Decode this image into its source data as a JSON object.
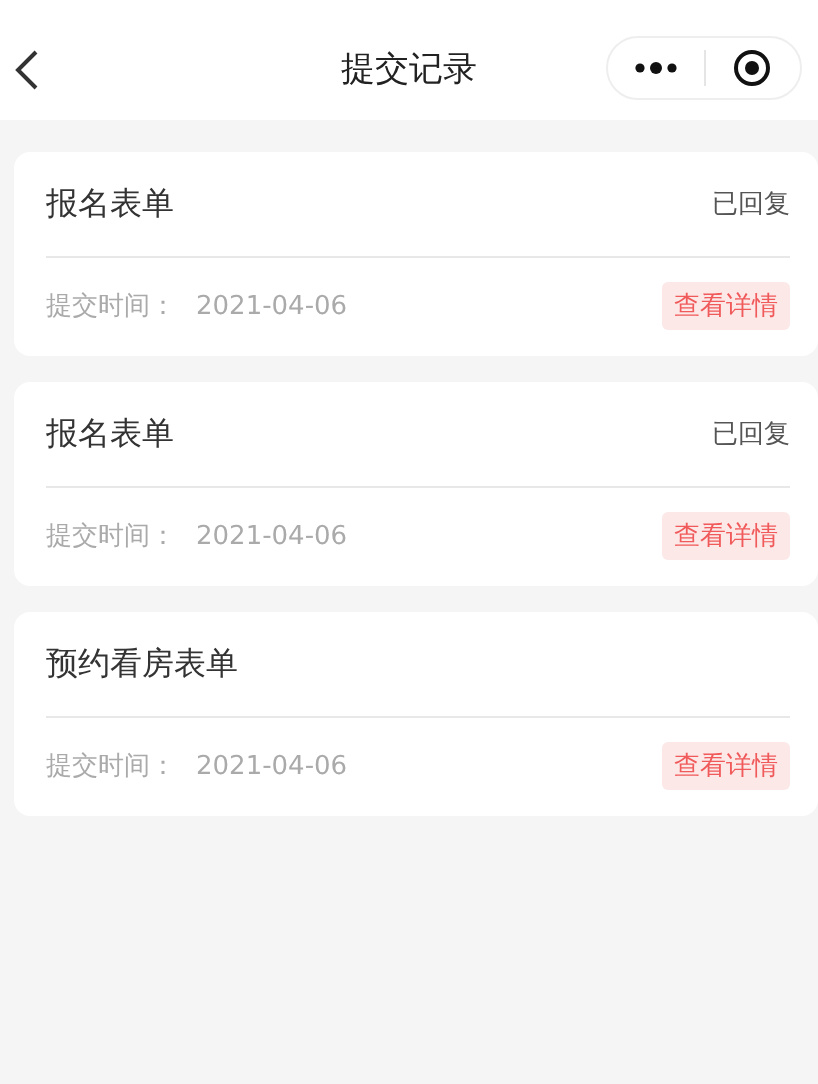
{
  "nav_bar": {
    "title": "提交记录"
  },
  "records": [
    {
      "title": "报名表单",
      "status": "已回复",
      "time_label": "提交时间：",
      "date": "2021-04-06",
      "action": "查看详情"
    },
    {
      "title": "报名表单",
      "status": "已回复",
      "time_label": "提交时间：",
      "date": "2021-04-06",
      "action": "查看详情"
    },
    {
      "title": "预约看房表单",
      "time_label": "提交时间：",
      "date": "2021-04-06",
      "action": "查看详情"
    }
  ]
}
